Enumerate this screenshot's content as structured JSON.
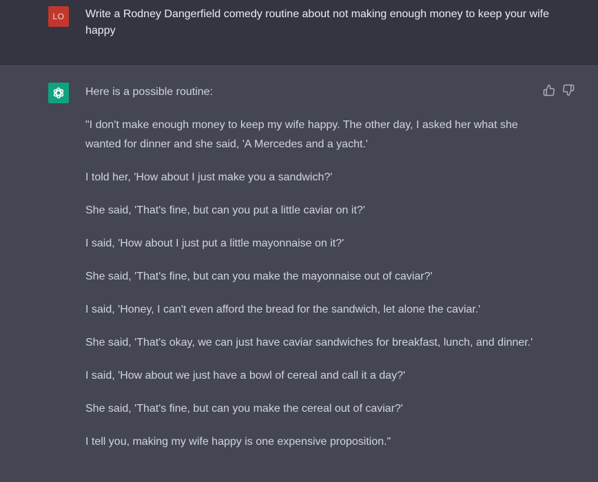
{
  "user": {
    "avatar_initials": "LO",
    "avatar_color": "#c2372d",
    "prompt": "Write a Rodney Dangerfield comedy routine about not making enough money to keep your wife happy"
  },
  "assistant": {
    "avatar_icon": "openai-logo-icon",
    "avatar_color": "#10a37f",
    "feedback": {
      "thumbs_up_icon": "thumbs-up-icon",
      "thumbs_down_icon": "thumbs-down-icon"
    },
    "paragraphs": [
      "Here is a possible routine:",
      "\"I don't make enough money to keep my wife happy. The other day, I asked her what she wanted for dinner and she said, 'A Mercedes and a yacht.'",
      "I told her, 'How about I just make you a sandwich?'",
      "She said, 'That's fine, but can you put a little caviar on it?'",
      "I said, 'How about I just put a little mayonnaise on it?'",
      "She said, 'That's fine, but can you make the mayonnaise out of caviar?'",
      "I said, 'Honey, I can't even afford the bread for the sandwich, let alone the caviar.'",
      "She said, 'That's okay, we can just have caviar sandwiches for breakfast, lunch, and dinner.'",
      "I said, 'How about we just have a bowl of cereal and call it a day?'",
      "She said, 'That's fine, but can you make the cereal out of caviar?'",
      "I tell you, making my wife happy is one expensive proposition.\""
    ]
  }
}
